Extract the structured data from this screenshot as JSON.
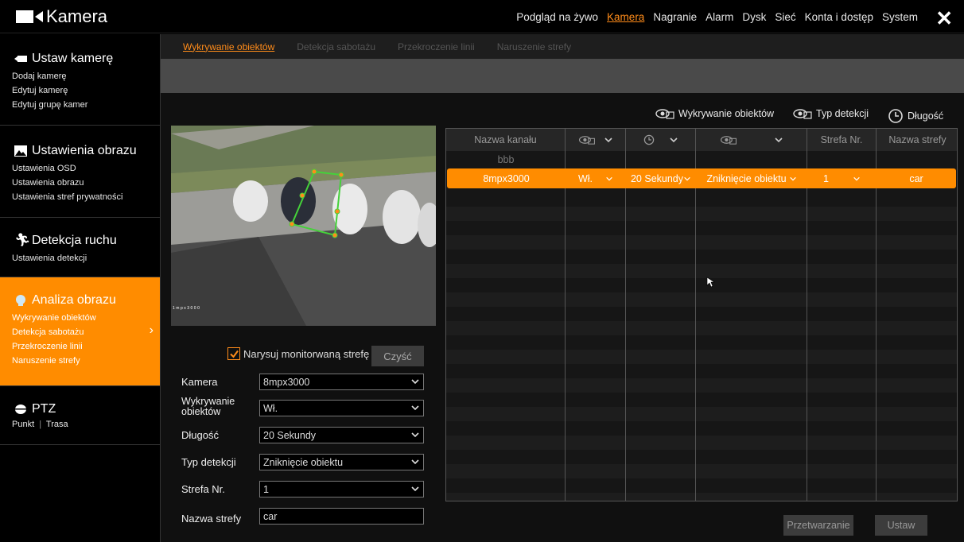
{
  "app": {
    "title": "Kamera"
  },
  "topnav": [
    "Podgląd na żywo",
    "Kamera",
    "Nagranie",
    "Alarm",
    "Dysk",
    "Sieć",
    "Konta i dostęp",
    "System"
  ],
  "sidebar": {
    "setup": {
      "title": "Ustaw kamerę",
      "items": [
        "Dodaj kamerę",
        "Edytuj kamerę",
        "Edytuj grupę kamer"
      ]
    },
    "image": {
      "title": "Ustawienia obrazu",
      "items": [
        "Ustawienia OSD",
        "Ustawienia obrazu",
        "Ustawienia stref prywatności"
      ]
    },
    "motion": {
      "title": "Detekcja ruchu",
      "items": [
        "Ustawienia detekcji"
      ]
    },
    "analysis": {
      "title": "Analiza obrazu",
      "items": [
        "Wykrywanie obiektów",
        "Detekcja sabotażu",
        "Przekroczenie linii",
        "Naruszenie strefy"
      ]
    },
    "ptz": {
      "title": "PTZ",
      "item_point": "Punkt",
      "item_route": "Trasa"
    }
  },
  "tabs": [
    "Wykrywanie obiektów",
    "Detekcja sabotażu",
    "Przekroczenie linii",
    "Naruszenie strefy"
  ],
  "legend": {
    "detection": "Wykrywanie obiektów",
    "type": "Typ detekcji",
    "duration": "Długość"
  },
  "preview": {
    "osd": "1mpx3000"
  },
  "draw_zone": {
    "label": "Narysuj monitorwaną strefę",
    "checked": true,
    "clear_label": "Czyść"
  },
  "form": {
    "camera": {
      "label": "Kamera",
      "value": "8mpx3000"
    },
    "detection": {
      "label": "Wykrywanie obiektów",
      "value": "Wł."
    },
    "duration": {
      "label": "Długość",
      "value": "20 Sekundy"
    },
    "type": {
      "label": "Typ detekcji",
      "value": "Zniknięcie obiektu"
    },
    "zone_no": {
      "label": "Strefa Nr.",
      "value": "1"
    },
    "zone_name": {
      "label": "Nazwa strefy",
      "value": "car"
    }
  },
  "table": {
    "headers": {
      "channel": "Nazwa kanału",
      "zone_no": "Strefa Nr.",
      "zone_name": "Nazwa strefy"
    },
    "group_row": "bbb",
    "selected_row": {
      "channel": "8mpx3000",
      "detection": "Wł.",
      "duration": "20 Sekundy",
      "type": "Zniknięcie obiektu",
      "zone_no": "1",
      "zone_name": "car"
    }
  },
  "buttons": {
    "process": "Przetwarzanie",
    "set": "Ustaw"
  },
  "colors": {
    "accent": "#ff8c00",
    "background": "#000000",
    "panel": "#101010"
  }
}
